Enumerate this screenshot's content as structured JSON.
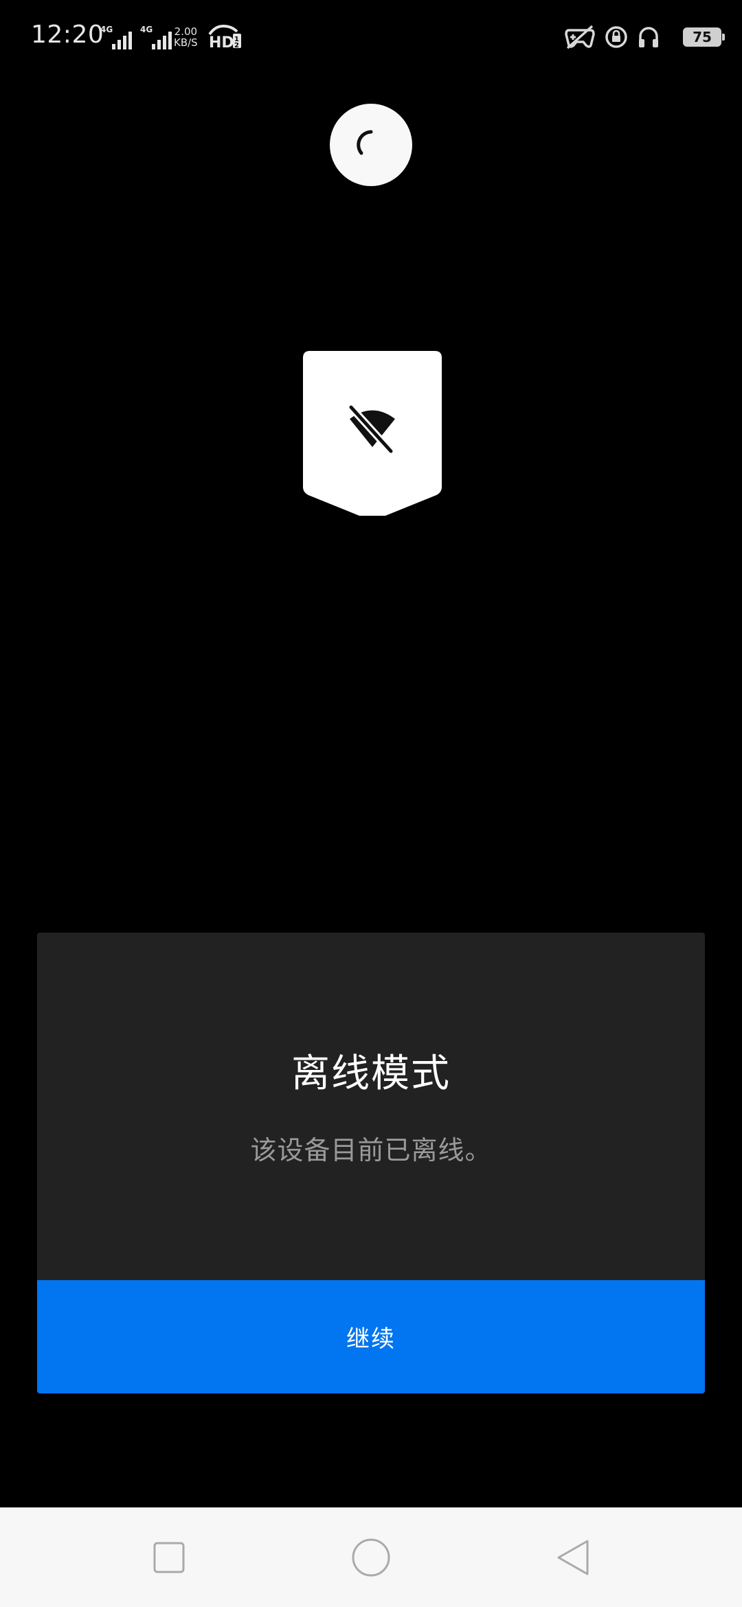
{
  "status_bar": {
    "time": "12:20",
    "network_tag_1": "4G",
    "network_tag_2": "4G",
    "speed_value": "2.00",
    "speed_unit": "KB/S",
    "battery_level": "75",
    "icons": [
      "signal-4g-icon",
      "signal-4g-icon",
      "hd-voice-icon",
      "game-mode-icon",
      "rotation-lock-icon",
      "headphones-icon",
      "battery-icon"
    ]
  },
  "loading": {
    "icon": "spinner-icon"
  },
  "offline_badge": {
    "icon": "wifi-off-icon"
  },
  "dialog": {
    "title": "离线模式",
    "message": "该设备目前已离线。",
    "continue_label": "继续"
  },
  "nav_bar": {
    "icons": [
      "recents-square-icon",
      "home-circle-icon",
      "back-triangle-icon"
    ]
  },
  "colors": {
    "background": "#000000",
    "dialog_background": "#222222",
    "accent": "#0275f0",
    "nav_background": "#f7f7f7"
  }
}
